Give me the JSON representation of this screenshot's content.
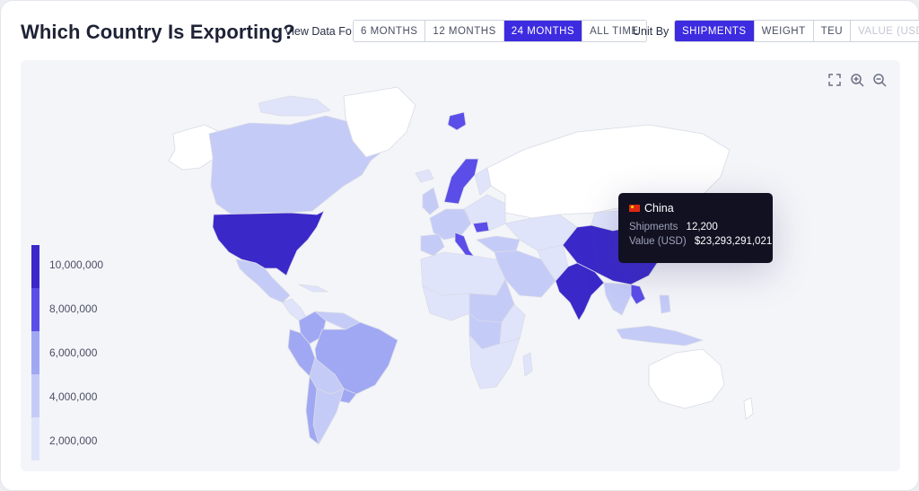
{
  "title": "Which Country Is Exporting?",
  "view_data": {
    "label": "View Data Fo",
    "options": [
      "6 MONTHS",
      "12 MONTHS",
      "24 MONTHS",
      "ALL TIME"
    ],
    "selected": "24 MONTHS"
  },
  "unit_by": {
    "label": "Unit By",
    "options": [
      "SHIPMENTS",
      "WEIGHT",
      "TEU",
      "VALUE (USD)"
    ],
    "selected": "SHIPMENTS",
    "disabled": [
      "VALUE (USD)"
    ]
  },
  "map_tools": [
    "fullscreen-icon",
    "zoom-in-icon",
    "zoom-out-icon"
  ],
  "legend": {
    "ticks": [
      "10,000,000",
      "8,000,000",
      "6,000,000",
      "4,000,000",
      "2,000,000"
    ],
    "colors": [
      "#3b28c9",
      "#5b4de8",
      "#a0a8f4",
      "#c5cbf7",
      "#e0e4fb"
    ]
  },
  "colors": {
    "accent": "#3d2be0",
    "no_data": "#ffffff",
    "tier_1": "#3b28c9",
    "tier_2": "#5b4de8",
    "tier_3": "#a0a8f4",
    "tier_4": "#c5cbf7",
    "tier_5": "#e0e4fb"
  },
  "map": {
    "highlighted_countries": {
      "United States": "tier_1",
      "China": "tier_1",
      "India": "tier_1",
      "Vietnam": "tier_2",
      "Norway": "tier_2",
      "Sweden": "tier_2",
      "Svalbard": "tier_2",
      "Italy": "tier_2",
      "Hungary": "tier_2",
      "Brazil": "tier_3",
      "Colombia": "tier_3",
      "Peru": "tier_3",
      "Chile": "tier_3",
      "Argentina": "tier_4",
      "Canada": "tier_4",
      "Mexico": "tier_4",
      "Sudan": "tier_4",
      "DR Congo": "tier_4"
    }
  },
  "tooltip": {
    "country": "China",
    "rows": [
      {
        "key": "Shipments",
        "value": "12,200"
      },
      {
        "key": "Value (USD)",
        "value": "$23,293,291,021"
      }
    ]
  }
}
